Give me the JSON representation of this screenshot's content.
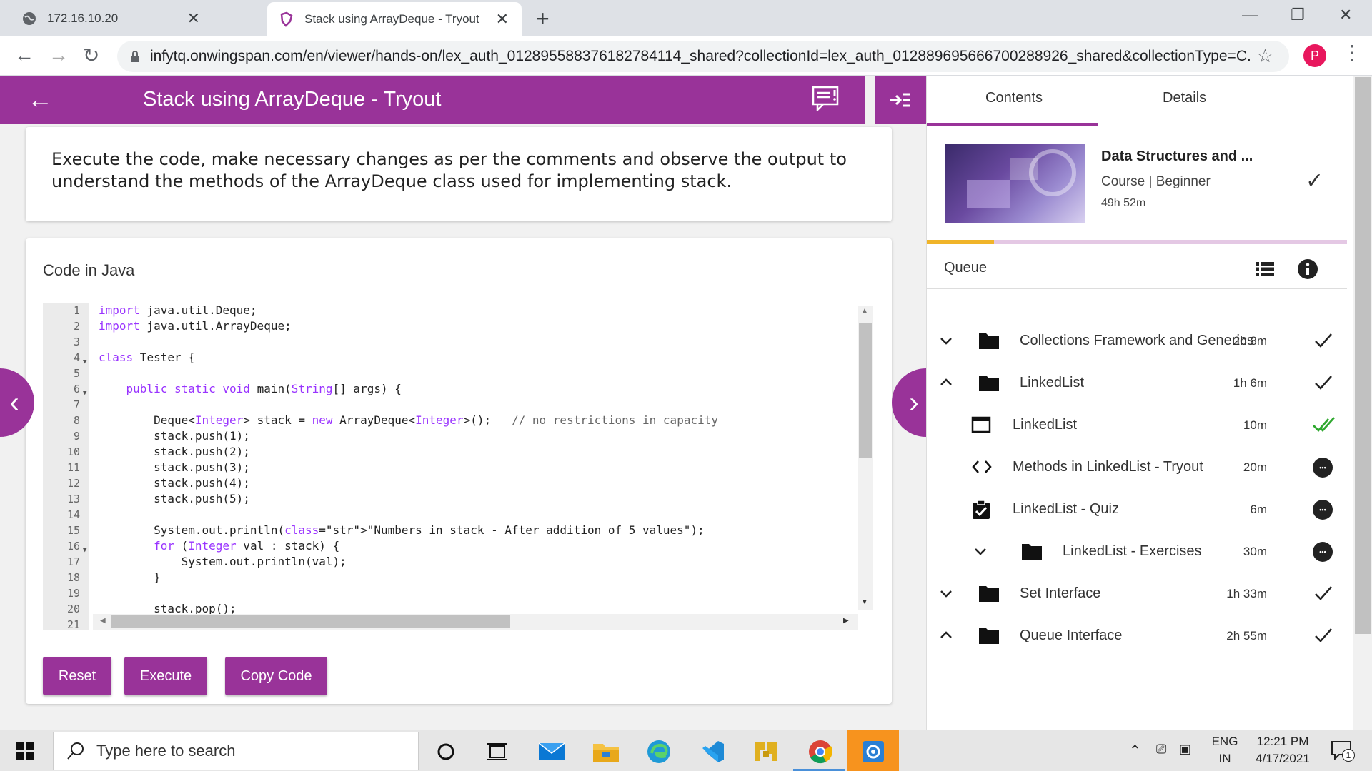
{
  "browser": {
    "tab1_title": "172.16.10.20",
    "tab2_title": "Stack using ArrayDeque - Tryout",
    "close_glyph": "✕",
    "new_tab_glyph": "+",
    "url": "infytq.onwingspan.com/en/viewer/hands-on/lex_auth_012895588376182784114_shared?collectionId=lex_auth_012889695666700288926_shared&collectionType=C...",
    "profile_initial": "P"
  },
  "header": {
    "title": "Stack using ArrayDeque - Tryout"
  },
  "instructions": {
    "text": "Execute the code, make necessary changes as per the comments and observe the output to understand the methods of the ArrayDeque class used for implementing stack."
  },
  "code_section": {
    "heading": "Code in Java",
    "lines": [
      {
        "n": "1",
        "text": "import java.util.Deque;"
      },
      {
        "n": "2",
        "text": "import java.util.ArrayDeque;"
      },
      {
        "n": "3",
        "text": ""
      },
      {
        "n": "4",
        "text": "class Tester {"
      },
      {
        "n": "5",
        "text": ""
      },
      {
        "n": "6",
        "text": "    public static void main(String[] args) {"
      },
      {
        "n": "7",
        "text": ""
      },
      {
        "n": "8",
        "text": "        Deque<Integer> stack = new ArrayDeque<Integer>();   // no restrictions in capacity"
      },
      {
        "n": "9",
        "text": "        stack.push(1);"
      },
      {
        "n": "10",
        "text": "        stack.push(2);"
      },
      {
        "n": "11",
        "text": "        stack.push(3);"
      },
      {
        "n": "12",
        "text": "        stack.push(4);"
      },
      {
        "n": "13",
        "text": "        stack.push(5);"
      },
      {
        "n": "14",
        "text": ""
      },
      {
        "n": "15",
        "text": "        System.out.println(\"Numbers in stack - After addition of 5 values\");"
      },
      {
        "n": "16",
        "text": "        for (Integer val : stack) {"
      },
      {
        "n": "17",
        "text": "            System.out.println(val);"
      },
      {
        "n": "18",
        "text": "        }"
      },
      {
        "n": "19",
        "text": ""
      },
      {
        "n": "20",
        "text": "        stack.pop();"
      },
      {
        "n": "21",
        "text": ""
      }
    ],
    "buttons": {
      "reset": "Reset",
      "execute": "Execute",
      "copy": "Copy Code"
    }
  },
  "right_panel": {
    "tab_contents": "Contents",
    "tab_details": "Details",
    "course": {
      "title": "Data Structures and ...",
      "meta": "Course |  Beginner",
      "duration": "49h 52m",
      "progress_fraction": 0.16
    },
    "queue_label": "Queue",
    "toc": [
      {
        "label": "Collections Framework and Generics",
        "duration": "2h 8m",
        "status": "check",
        "chevron": "down",
        "icon": "folder-icon"
      },
      {
        "label": "LinkedList",
        "duration": "1h 6m",
        "status": "check",
        "chevron": "up",
        "icon": "folder-icon"
      },
      {
        "label": "LinkedList",
        "duration": "10m",
        "status": "double-check",
        "chevron": "",
        "icon": "window-icon"
      },
      {
        "label": "Methods in LinkedList - Tryout",
        "duration": "20m",
        "status": "more",
        "chevron": "",
        "icon": "code-icon"
      },
      {
        "label": "LinkedList - Quiz",
        "duration": "6m",
        "status": "more",
        "chevron": "",
        "icon": "quiz-icon"
      },
      {
        "label": "LinkedList - Exercises",
        "duration": "30m",
        "status": "more",
        "chevron": "down",
        "icon": "folder-icon"
      },
      {
        "label": "Set Interface",
        "duration": "1h 33m",
        "status": "check",
        "chevron": "down",
        "icon": "folder-icon"
      },
      {
        "label": "Queue Interface",
        "duration": "2h 55m",
        "status": "check",
        "chevron": "up",
        "icon": "folder-icon"
      }
    ]
  },
  "taskbar": {
    "search_placeholder": "Type here to search",
    "lang_top": "ENG",
    "lang_bottom": "IN",
    "time": "12:21 PM",
    "date": "4/17/2021",
    "notif_count": "1"
  },
  "colors": {
    "brand": "#993399",
    "progress": "#f0b429",
    "done_green": "#2fa82f"
  }
}
